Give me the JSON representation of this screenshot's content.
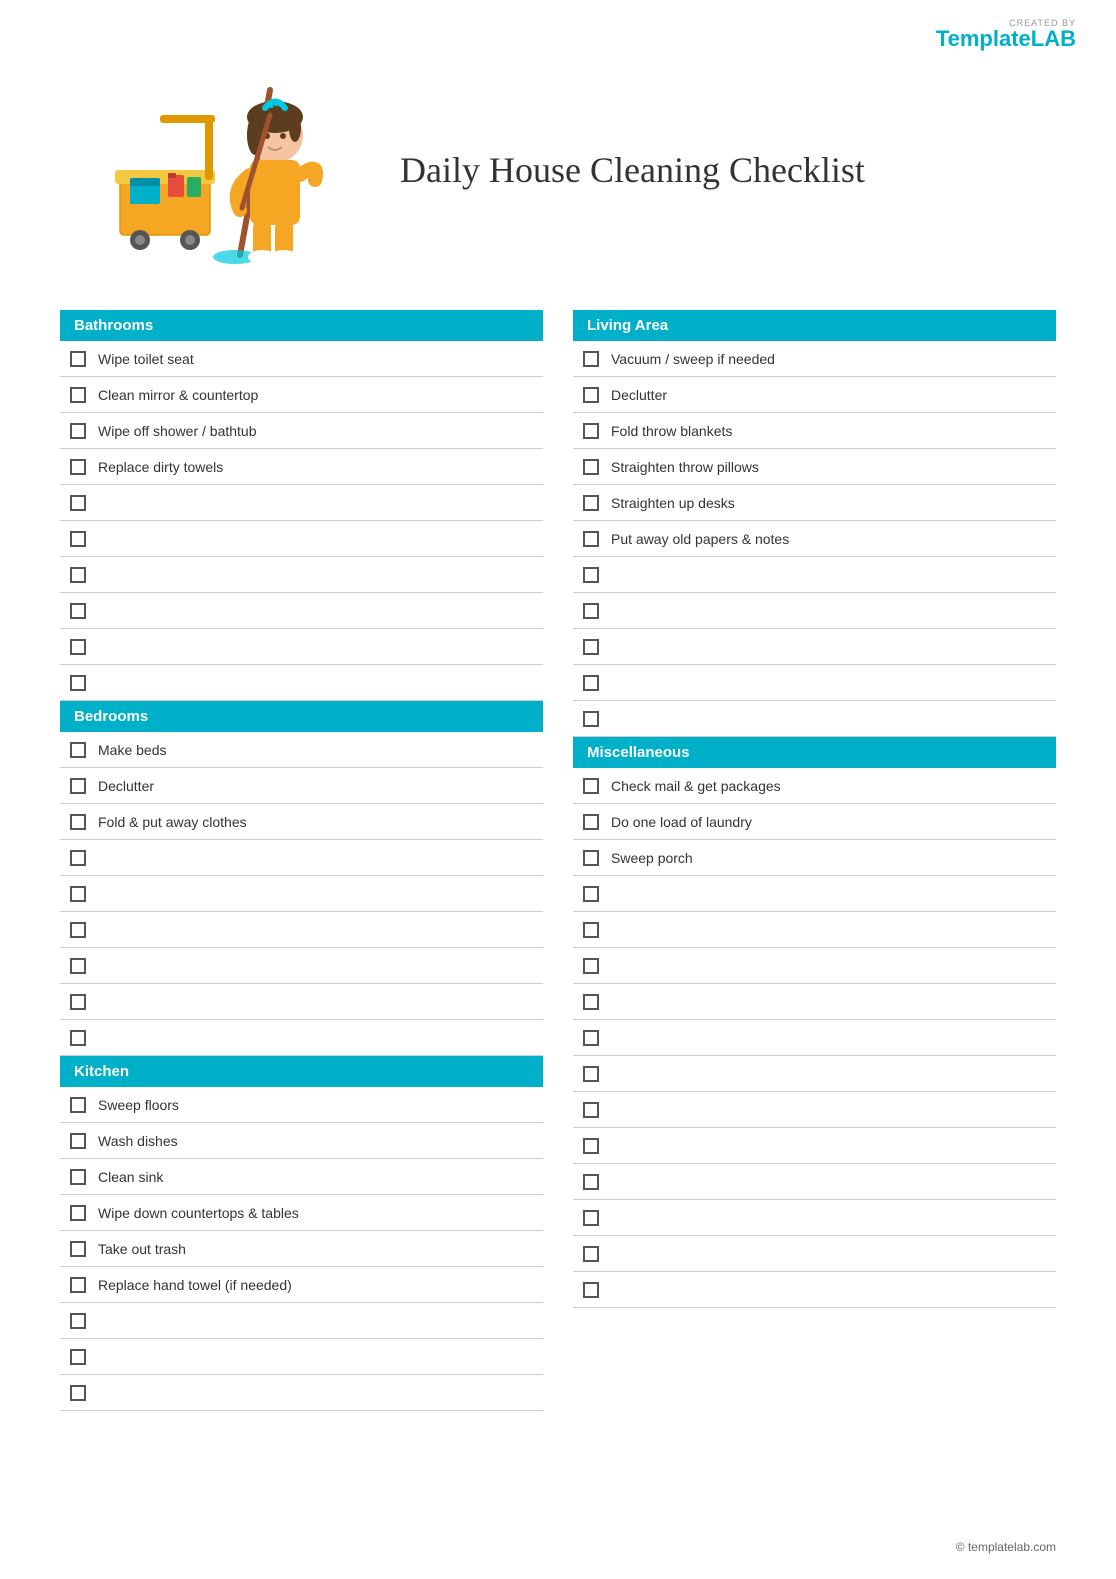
{
  "logo": {
    "created_by": "CREATED BY",
    "template": "Template",
    "lab": "LAB"
  },
  "title": "Daily House Cleaning Checklist",
  "sections": {
    "left": [
      {
        "id": "bathrooms",
        "header": "Bathrooms",
        "items": [
          "Wipe toilet seat",
          "Clean mirror & countertop",
          "Wipe off shower / bathtub",
          "Replace dirty towels",
          "",
          "",
          "",
          "",
          "",
          ""
        ]
      },
      {
        "id": "bedrooms",
        "header": "Bedrooms",
        "items": [
          "Make beds",
          "Declutter",
          "Fold & put away clothes",
          "",
          "",
          "",
          "",
          "",
          ""
        ]
      },
      {
        "id": "kitchen",
        "header": "Kitchen",
        "items": [
          "Sweep floors",
          "Wash dishes",
          "Clean sink",
          "Wipe down countertops & tables",
          "Take out trash",
          "Replace hand towel (if needed)",
          "",
          "",
          ""
        ]
      }
    ],
    "right": [
      {
        "id": "living-area",
        "header": "Living Area",
        "items": [
          "Vacuum / sweep if needed",
          "Declutter",
          "Fold throw blankets",
          "Straighten throw pillows",
          "Straighten up desks",
          "Put away old papers & notes",
          "",
          "",
          "",
          "",
          ""
        ]
      },
      {
        "id": "miscellaneous",
        "header": "Miscellaneous",
        "items": [
          "Check mail & get packages",
          "Do one load of laundry",
          "Sweep porch",
          "",
          "",
          "",
          "",
          "",
          "",
          "",
          "",
          "",
          "",
          "",
          ""
        ]
      }
    ]
  },
  "footer": "© templatelab.com"
}
